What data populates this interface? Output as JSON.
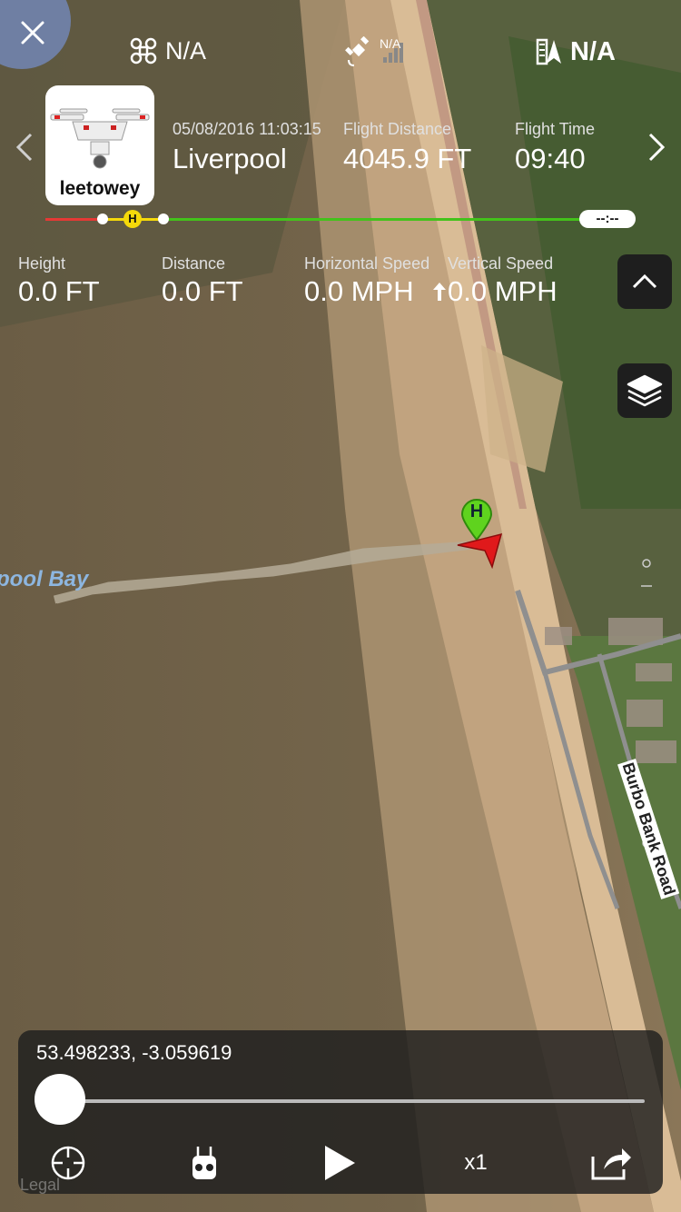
{
  "header": {
    "aircraft_status": "N/A",
    "gps_status": "N/A",
    "compass_status": "N/A"
  },
  "flight": {
    "pilot": "leetowey",
    "datetime": "05/08/2016 11:03:15",
    "location": "Liverpool",
    "distance_label": "Flight Distance",
    "distance_value": "4045.9 FT",
    "time_label": "Flight Time",
    "time_value": "09:40",
    "timeline_end": "--:--",
    "home_marker": "H"
  },
  "telemetry": {
    "height_label": "Height",
    "height_value": "0.0 FT",
    "distance_label": "Distance",
    "distance_value": "0.0 FT",
    "hspeed_label": "Horizontal Speed",
    "hspeed_value": "0.0 MPH",
    "vspeed_label": "Vertical Speed",
    "vspeed_value": "0.0 MPH"
  },
  "map": {
    "bay_label": "pool Bay",
    "road_label": "Burbo Bank Road",
    "home_marker": "H",
    "legal": "Legal"
  },
  "playback": {
    "coordinates": "53.498233, -3.059619",
    "speed": "x1",
    "progress": 0
  },
  "icons": {
    "close": "close-icon",
    "drone": "drone-icon",
    "satellite": "satellite-icon",
    "compass": "compass-icon",
    "prev": "chevron-left-icon",
    "next": "chevron-right-icon",
    "collapse": "chevron-up-icon",
    "layers": "layers-icon",
    "locate": "crosshair-icon",
    "remote": "remote-controller-icon",
    "play": "play-icon",
    "share": "share-icon"
  },
  "colors": {
    "track_red": "#e53935",
    "track_green": "#43c21b",
    "home_yellow": "#f5d90a",
    "aircraft_red": "#e0191b",
    "home_pin_green": "#5fd31e"
  }
}
